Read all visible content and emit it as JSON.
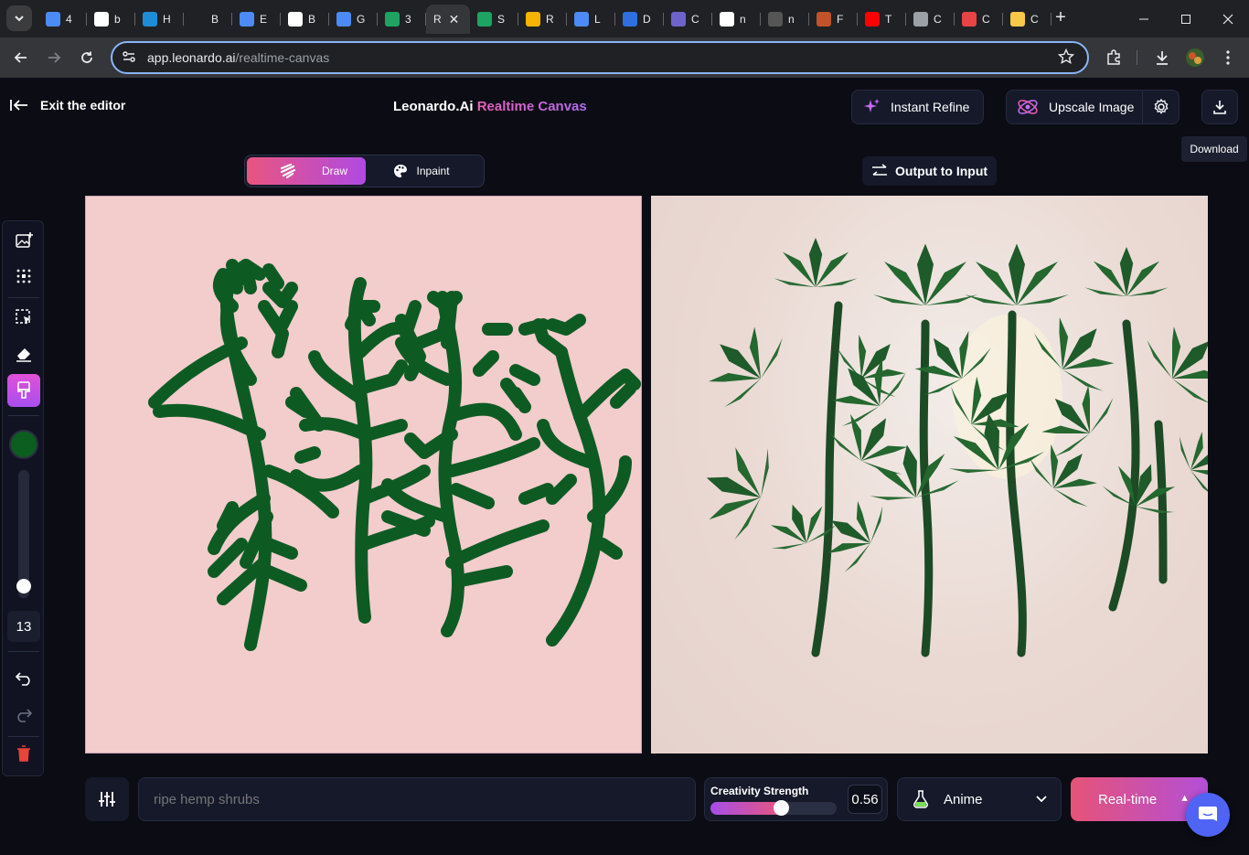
{
  "browser": {
    "tabs": [
      {
        "label": "4",
        "icon": "search-icon",
        "color": "#4c8bf5"
      },
      {
        "label": "b",
        "icon": "circle-logo-icon",
        "color": "#ffffff"
      },
      {
        "label": "H",
        "icon": "hub-icon",
        "color": "#1f8dd6"
      },
      {
        "label": "B",
        "icon": "blank-icon",
        "color": "#202124"
      },
      {
        "label": "E",
        "icon": "puzzle-icon",
        "color": "#4c8bf5"
      },
      {
        "label": "B",
        "icon": "openai-icon",
        "color": "#ffffff"
      },
      {
        "label": "G",
        "icon": "translate-icon",
        "color": "#4c8bf5"
      },
      {
        "label": "3",
        "icon": "sheets-icon",
        "color": "#1ea362"
      },
      {
        "label": "R",
        "icon": "leonardo-icon",
        "color": "#202124",
        "active": true
      },
      {
        "label": "S",
        "icon": "sheets-round-icon",
        "color": "#1ea362"
      },
      {
        "label": "R",
        "icon": "grad-cap-icon",
        "color": "#f4b400"
      },
      {
        "label": "L",
        "icon": "list-icon",
        "color": "#4c8bf5"
      },
      {
        "label": "D",
        "icon": "diamond-icon",
        "color": "#2f6fe0"
      },
      {
        "label": "C",
        "icon": "b-circle-icon",
        "color": "#6e63c8"
      },
      {
        "label": "n",
        "icon": "m-circle-icon",
        "color": "#ffffff"
      },
      {
        "label": "n",
        "icon": "ring-icon",
        "color": "#555555"
      },
      {
        "label": "F",
        "icon": "flame-icon",
        "color": "#c0532a"
      },
      {
        "label": "T",
        "icon": "youtube-icon",
        "color": "#ff0000"
      },
      {
        "label": "C",
        "icon": "globe-icon",
        "color": "#9aa0a6"
      },
      {
        "label": "C",
        "icon": "castle-icon",
        "color": "#e84444"
      },
      {
        "label": "C",
        "icon": "smiley-icon",
        "color": "#f7c948"
      }
    ],
    "url_host": "app.leonardo.ai",
    "url_path": "/realtime-canvas"
  },
  "app": {
    "exit_label": "Exit the editor",
    "brand_name": "Leonardo.Ai",
    "brand_product": "Realtime Canvas",
    "instant_refine": "Instant Refine",
    "upscale_image": "Upscale Image",
    "download_tooltip": "Download",
    "mode_draw": "Draw",
    "mode_inpaint": "Inpaint",
    "output_to_input": "Output to Input",
    "brush_size": "13",
    "brush_color": "#0b5e1f",
    "brush_size_level": 0.05,
    "prompt_placeholder": "ripe hemp shrubs",
    "creativity_label": "Creativity Strength",
    "creativity_value": "0.56",
    "creativity_level": 0.56,
    "style_label": "Anime",
    "realtime_label": "Real-time",
    "accent_gradient": [
      "#e9557f",
      "#b04ae3"
    ]
  }
}
